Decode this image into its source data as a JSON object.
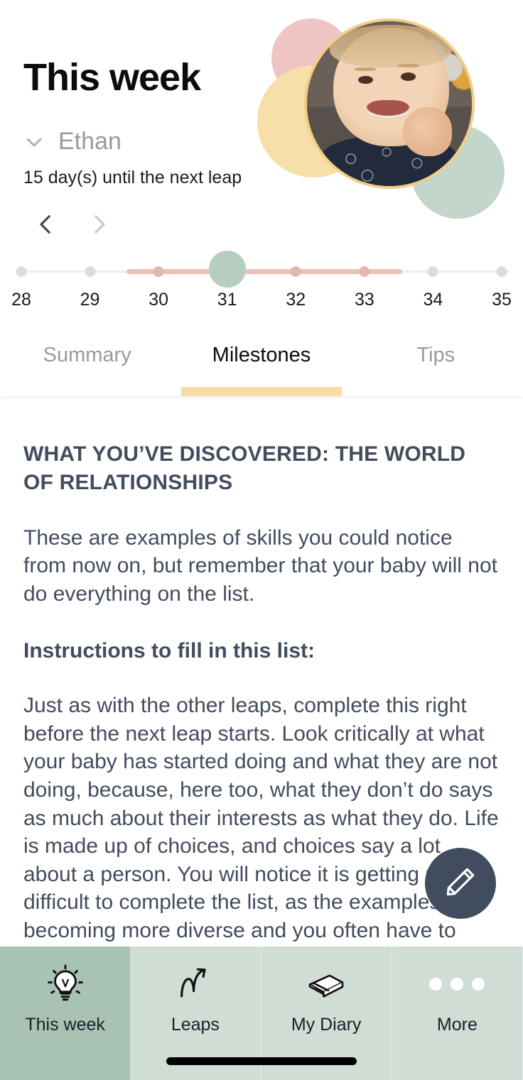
{
  "header": {
    "title": "This week",
    "child_name": "Ethan",
    "child_dropdown_icon": "chevron-down-icon",
    "countdown": "15 day(s) until the next leap",
    "prev_icon": "chevron-left-icon",
    "next_icon": "chevron-right-icon",
    "avatar_icon": "baby-photo-avatar",
    "colors": {
      "deco_pink": "#EFC4C4",
      "deco_yellow": "#F6DFA8",
      "deco_green": "#C3D6CC",
      "avatar_ring": "#F0CE86"
    }
  },
  "week_slider": {
    "ticks": [
      "28",
      "29",
      "30",
      "31",
      "32",
      "33",
      "34",
      "35"
    ],
    "selected": "31",
    "range_start": "30",
    "range_end": "33",
    "track_color": "#ECECEC",
    "range_color": "#EDBFB8",
    "thumb_color": "#B6CEC0"
  },
  "tabs": [
    {
      "label": "Summary",
      "active": false
    },
    {
      "label": "Milestones",
      "active": true
    },
    {
      "label": "Tips",
      "active": false
    }
  ],
  "tab_underline_color": "#F7DCA6",
  "content": {
    "heading": "WHAT YOU’VE DISCOVERED: THE WORLD OF RELATIONSHIPS",
    "intro": "These are examples of skills you could notice from now on, but remember that your baby will not do everything on the list.",
    "subheading": "Instructions to fill in this list:",
    "body": "Just as with the other leaps, complete this right before the next leap starts. Look critically at what your baby has started doing and what they are not doing, because, here too, what they don’t do says as much about their interests as what they do. Life is made up of choices, and choices say a lot about a person. You will notice it is getting more difficult to complete the list, as the examples are becoming more diverse and you often have to",
    "text_color": "#414C5E"
  },
  "fab": {
    "icon": "pencil-edit-icon",
    "background": "#414C5E"
  },
  "bottom_nav": {
    "items": [
      {
        "label": "This week",
        "icon": "lightbulb-icon",
        "active": true
      },
      {
        "label": "Leaps",
        "icon": "curved-arrow-icon",
        "active": false
      },
      {
        "label": "My Diary",
        "icon": "book-icon",
        "active": false
      },
      {
        "label": "More",
        "icon": "three-dots-icon",
        "active": false
      }
    ],
    "active_background": "#A8C3B4",
    "background": "#CFDDD4"
  }
}
